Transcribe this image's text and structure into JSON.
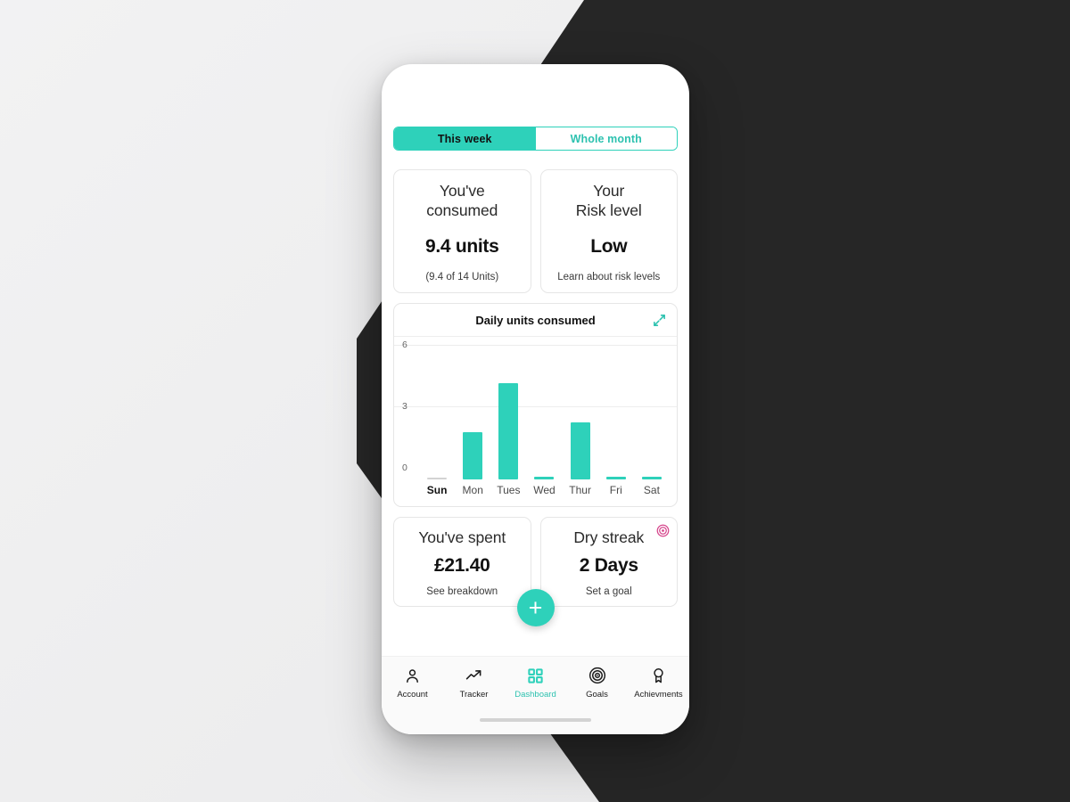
{
  "app": {
    "segmented": {
      "options": [
        {
          "label": "This week",
          "active": true
        },
        {
          "label": "Whole month",
          "active": false
        }
      ]
    },
    "summary_cards": [
      {
        "title_line1": "You've",
        "title_line2": "consumed",
        "value": "9.4 units",
        "sub": "(9.4 of 14 Units)"
      },
      {
        "title_line1": "Your",
        "title_line2": "Risk level",
        "value": "Low",
        "sub": "Learn about risk levels"
      }
    ],
    "chart_card": {
      "title": "Daily units consumed",
      "expand_icon": "expand-diagonal-icon"
    },
    "stat_cards": [
      {
        "title": "You've spent",
        "value": "£21.40",
        "sub": "See breakdown",
        "icon": null
      },
      {
        "title": "Dry streak",
        "value": "2 Days",
        "sub": "Set a goal",
        "icon": "target-icon"
      }
    ],
    "fab": {
      "label": "+",
      "icon": "plus-icon"
    },
    "nav": {
      "items": [
        {
          "label": "Account",
          "icon": "person-icon",
          "active": false
        },
        {
          "label": "Tracker",
          "icon": "trending-up-icon",
          "active": false
        },
        {
          "label": "Dashboard",
          "icon": "grid-icon",
          "active": true
        },
        {
          "label": "Goals",
          "icon": "target-rings-icon",
          "active": false
        },
        {
          "label": "Achievments",
          "icon": "award-medal-icon",
          "active": false
        }
      ]
    }
  },
  "colors": {
    "accent_teal": "#2ed1ba",
    "accent_teal_text": "#2ec2b0",
    "pink": "#d6468c",
    "dark_bg": "#262626",
    "light_bg": "#efeff0"
  },
  "chart_data": {
    "type": "bar",
    "title": "Daily units consumed",
    "categories": [
      "Sun",
      "Mon",
      "Tues",
      "Wed",
      "Thur",
      "Fri",
      "Sat"
    ],
    "values": [
      0,
      2.3,
      4.7,
      0.05,
      2.8,
      0.05,
      0.05
    ],
    "xlabel": "",
    "ylabel": "",
    "ylim": [
      0,
      6
    ],
    "yticks": [
      0,
      3,
      6
    ],
    "grid": true,
    "legend": false,
    "highlight_category": "Sun",
    "bar_color": "#2ed1ba",
    "zero_bar_color": "#d3d3d3"
  }
}
